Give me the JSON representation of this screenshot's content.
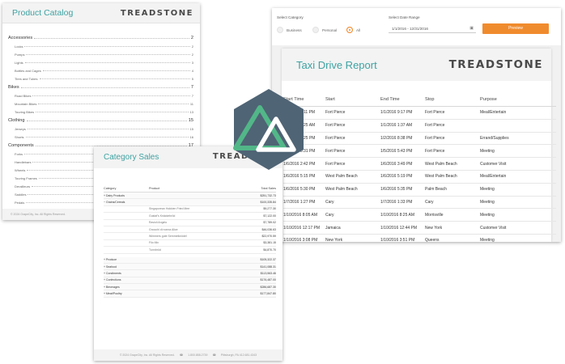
{
  "catalog": {
    "title": "Product Catalog",
    "brand": "TREADSTONE",
    "toc": [
      {
        "type": "cat",
        "label": "Accessories",
        "page": "2"
      },
      {
        "type": "sub",
        "label": "Locks",
        "page": "2"
      },
      {
        "type": "sub",
        "label": "Pumps",
        "page": "2"
      },
      {
        "type": "sub",
        "label": "Lights",
        "page": "3"
      },
      {
        "type": "sub",
        "label": "Bottles and Cages",
        "page": "4"
      },
      {
        "type": "sub",
        "label": "Tires and Tubes",
        "page": "5"
      },
      {
        "type": "cat",
        "label": "Bikes",
        "page": "7"
      },
      {
        "type": "sub",
        "label": "Road Bikes",
        "page": "7"
      },
      {
        "type": "sub",
        "label": "Mountain Bikes",
        "page": "11"
      },
      {
        "type": "sub",
        "label": "Touring Bikes",
        "page": "13"
      },
      {
        "type": "cat",
        "label": "Clothing",
        "page": "15"
      },
      {
        "type": "sub",
        "label": "Jerseys",
        "page": "15"
      },
      {
        "type": "sub",
        "label": "Shorts",
        "page": "16"
      },
      {
        "type": "cat",
        "label": "Components",
        "page": "17"
      },
      {
        "type": "sub",
        "label": "Forks",
        "page": "17"
      },
      {
        "type": "sub",
        "label": "Handlebars",
        "page": "18"
      },
      {
        "type": "sub",
        "label": "Wheels",
        "page": "19"
      },
      {
        "type": "sub",
        "label": "Touring Frames",
        "page": "20"
      },
      {
        "type": "sub",
        "label": "Derailleurs",
        "page": "21"
      },
      {
        "type": "sub",
        "label": "Saddles",
        "page": "22"
      },
      {
        "type": "sub",
        "label": "Pedals",
        "page": "23"
      },
      {
        "type": "sub",
        "label": "Chains",
        "page": "24"
      }
    ],
    "footer": "© 2024 GrapeCity, Inc. All Rights Reserved."
  },
  "taxi": {
    "select_category_label": "Select Category",
    "radios": [
      {
        "label": "Business",
        "selected": false
      },
      {
        "label": "Personal",
        "selected": false
      },
      {
        "label": "All",
        "selected": true
      }
    ],
    "date_range_label": "Select Date Range",
    "date_range_value": "1/1/2016 - 12/31/2016",
    "calendar_icon": "calendar-icon",
    "preview_label": "Preview",
    "report_title": "Taxi Drive Report",
    "brand": "TREADSTONE",
    "columns": [
      "Start Time",
      "Start",
      "End Time",
      "Stop",
      "Purpose"
    ],
    "rows": [
      [
        "1/1/2016 9:11 PM",
        "Fort Pierce",
        "1/1/2016 9:17 PM",
        "Fort Pierce",
        "Meal/Entertain"
      ],
      [
        "1/2/2016 1:25 AM",
        "Fort Pierce",
        "1/1/2016 1:37 AM",
        "Fort Pierce",
        ""
      ],
      [
        "1/2/2016 8:25 PM",
        "Fort Pierce",
        "1/2/2016 8:38 PM",
        "Fort Pierce",
        "Errand/Supplies"
      ],
      [
        "1/5/2016 5:31 PM",
        "Fort Pierce",
        "1/5/2016 5:43 PM",
        "Fort Pierce",
        "Meeting"
      ],
      [
        "1/6/2016 2:42 PM",
        "Fort Pierce",
        "1/6/2016 3:49 PM",
        "West Palm Beach",
        "Customer Visit"
      ],
      [
        "1/6/2016 5:15 PM",
        "West Palm Beach",
        "1/6/2016 5:19 PM",
        "West Palm Beach",
        "Meal/Entertain"
      ],
      [
        "1/6/2016 5:30 PM",
        "West Palm Beach",
        "1/6/2016 5:35 PM",
        "Palm Beach",
        "Meeting"
      ],
      [
        "1/7/2016 1:27 PM",
        "Cary",
        "1/7/2016 1:33 PM",
        "Cary",
        "Meeting"
      ],
      [
        "1/10/2016 8:05 AM",
        "Cary",
        "1/10/2016 8:25 AM",
        "Morrisville",
        "Meeting"
      ],
      [
        "1/10/2016 12:17 PM",
        "Jamaica",
        "1/10/2016 12:44 PM",
        "New York",
        "Customer Visit"
      ],
      [
        "1/10/2016 3:08 PM",
        "New York",
        "1/10/2016 3:51 PM",
        "Queens",
        "Meeting"
      ]
    ]
  },
  "sales": {
    "title": "Category Sales",
    "brand": "TREADSTONE",
    "columns": [
      "Category",
      "Product",
      "Total Sales"
    ],
    "rows": [
      {
        "type": "cat",
        "category": "+ Dairy Products",
        "product": "",
        "total": "$251,732.73"
      },
      {
        "type": "cat",
        "category": "− Grains/Cereals",
        "product": "",
        "total": "$100,335.84"
      },
      {
        "type": "prod",
        "category": "",
        "product": "Singaporean Hokkien Fried Mee",
        "total": "$9,277.30"
      },
      {
        "type": "prod",
        "category": "",
        "product": "Gustaf's Knäckebröd",
        "total": "$7,122.00"
      },
      {
        "type": "prod",
        "category": "",
        "product": "Ravioli Angelo",
        "total": "$7,789.02"
      },
      {
        "type": "prod",
        "category": "",
        "product": "Gnocchi di nonna Alice",
        "total": "$46,036.63"
      },
      {
        "type": "prod",
        "category": "",
        "product": "Wimmers gute Semmelknödel",
        "total": "$22,970.59"
      },
      {
        "type": "prod",
        "category": "",
        "product": "Filo Mix",
        "total": "$3,381.15"
      },
      {
        "type": "prod",
        "category": "",
        "product": "Tunnbröd",
        "total": "$4,870.70"
      },
      {
        "type": "gap",
        "category": "",
        "product": "",
        "total": ""
      },
      {
        "type": "cat",
        "category": "+ Produce",
        "product": "",
        "total": "$105,322.37"
      },
      {
        "type": "cat",
        "category": "+ Seafood",
        "product": "",
        "total": "$141,088.31"
      },
      {
        "type": "cat",
        "category": "+ Condiments",
        "product": "",
        "total": "$113,563.46"
      },
      {
        "type": "cat",
        "category": "+ Confections",
        "product": "",
        "total": "$176,487.00"
      },
      {
        "type": "cat",
        "category": "+ Beverages",
        "product": "",
        "total": "$286,687.30"
      },
      {
        "type": "cat",
        "category": "+ Meat/Poultry",
        "product": "",
        "total": "$177,847.80"
      }
    ],
    "footer_copyright": "© 2024 GrapeCity, Inc. All Rights Reserved.",
    "footer_phone": "1.800.858.2739",
    "footer_fax": "Pittsburgh, PA 412.681.4343"
  },
  "logo": {
    "icon": "triangle-logo-icon",
    "hex_color": "#4f6475",
    "outer_color": "#52b788",
    "inner_color": "#ffffff"
  }
}
